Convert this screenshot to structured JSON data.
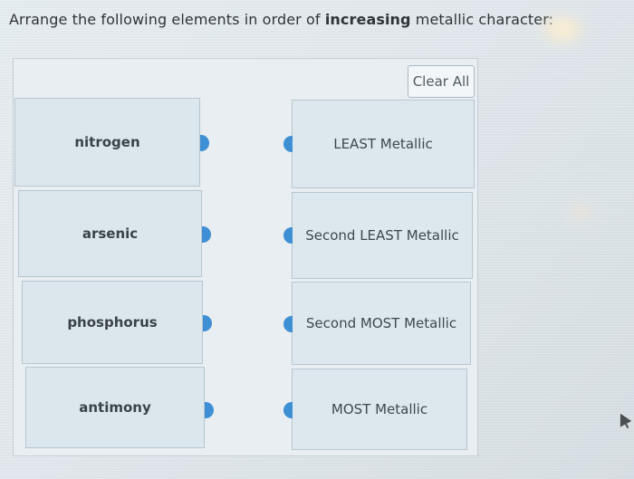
{
  "question": {
    "prefix": "Arrange the following elements in order of ",
    "emphasis": "increasing",
    "suffix": " metallic character:"
  },
  "toolbar": {
    "clear_all_label": "Clear All"
  },
  "items": [
    {
      "label": "nitrogen"
    },
    {
      "label": "arsenic"
    },
    {
      "label": "phosphorus"
    },
    {
      "label": "antimony"
    }
  ],
  "slots": [
    {
      "label": "LEAST Metallic"
    },
    {
      "label": "Second LEAST Metallic"
    },
    {
      "label": "Second MOST Metallic"
    },
    {
      "label": "MOST Metallic"
    }
  ],
  "colors": {
    "connector": "#3f8fd4",
    "tile_background": "#dce7ed",
    "tile_border": "#b7c6d0"
  }
}
